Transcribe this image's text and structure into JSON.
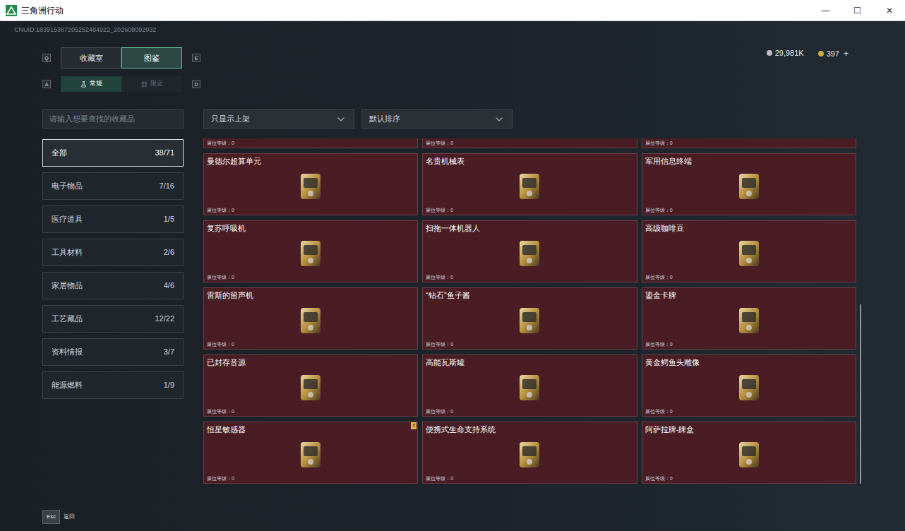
{
  "window": {
    "title": "三角洲行动",
    "controls": [
      "—",
      "☐",
      "✕"
    ]
  },
  "uid": "CNUID:183915387205252484922_202608092032",
  "tabs": {
    "prev_key": "Q",
    "next_key": "E",
    "items": [
      {
        "label": "收藏室",
        "selected": false
      },
      {
        "label": "图鉴",
        "selected": true
      }
    ]
  },
  "subtabs": {
    "prev_key": "A",
    "next_key": "D",
    "items": [
      {
        "label": "常规",
        "selected": true
      },
      {
        "label": "限定",
        "selected": false
      }
    ]
  },
  "currency": [
    {
      "amount": "29,981K",
      "action": ""
    },
    {
      "amount": "397",
      "action": "+"
    }
  ],
  "search": {
    "placeholder": "请输入想要查找的收藏品"
  },
  "filters": [
    {
      "label": "只显示上架"
    },
    {
      "label": "默认排序"
    }
  ],
  "categories": [
    {
      "label": "全部",
      "count": "38/71",
      "selected": true
    },
    {
      "label": "电子物品",
      "count": "7/16",
      "selected": false
    },
    {
      "label": "医疗道具",
      "count": "1/5",
      "selected": false
    },
    {
      "label": "工具材料",
      "count": "2/6",
      "selected": false
    },
    {
      "label": "家居物品",
      "count": "4/6",
      "selected": false
    },
    {
      "label": "工艺藏品",
      "count": "12/22",
      "selected": false
    },
    {
      "label": "资料情报",
      "count": "3/7",
      "selected": false
    },
    {
      "label": "能源燃料",
      "count": "1/9",
      "selected": false
    }
  ],
  "grid": {
    "mark_glyph": "!",
    "partial_row": [
      {
        "level_text": "展位等级：0"
      },
      {
        "level_text": "展位等级：0"
      },
      {
        "level_text": "展位等级：0"
      }
    ],
    "cards": [
      {
        "name": "曼德尔超算单元",
        "level_text": "展位等级：0",
        "marked": false
      },
      {
        "name": "名贵机械表",
        "level_text": "展位等级：0",
        "marked": false
      },
      {
        "name": "军用信息终端",
        "level_text": "展位等级：0",
        "marked": false
      },
      {
        "name": "复苏呼吸机",
        "level_text": "展位等级：0",
        "marked": false
      },
      {
        "name": "扫拖一体机器人",
        "level_text": "展位等级：0",
        "marked": false
      },
      {
        "name": "高级咖啡豆",
        "level_text": "展位等级：0",
        "marked": false
      },
      {
        "name": "雷斯的留声机",
        "level_text": "展位等级：0",
        "marked": false
      },
      {
        "name": "“钻石”鱼子酱",
        "level_text": "展位等级：0",
        "marked": false
      },
      {
        "name": "鎏金卡牌",
        "level_text": "展位等级：0",
        "marked": false
      },
      {
        "name": "已封存音源",
        "level_text": "展位等级：0",
        "marked": false
      },
      {
        "name": "高能瓦斯罐",
        "level_text": "展位等级：0",
        "marked": false
      },
      {
        "name": "黄金鳄鱼头雕像",
        "level_text": "展位等级：0",
        "marked": false
      },
      {
        "name": "恒星敏感器",
        "level_text": "展位等级：0",
        "marked": true
      },
      {
        "name": "便携式生命支持系统",
        "level_text": "展位等级：0",
        "marked": false
      },
      {
        "name": "阿萨拉牌-牌盒",
        "level_text": "展位等级：0",
        "marked": false
      }
    ]
  },
  "scrollbar": {
    "thumb_start": 0.48,
    "thumb_size": 0.52
  },
  "footer": {
    "key": "Esc",
    "label": "返回"
  }
}
